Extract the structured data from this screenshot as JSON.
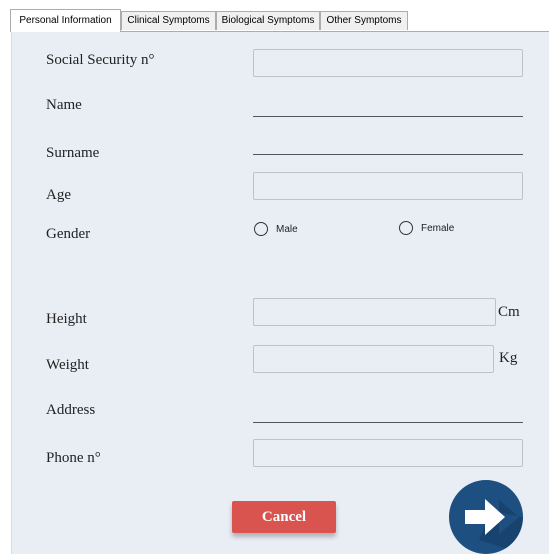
{
  "tabs": [
    {
      "label": "Personal Information",
      "active": true
    },
    {
      "label": "Clinical Symptoms",
      "active": false
    },
    {
      "label": "Biological Symptoms",
      "active": false
    },
    {
      "label": "Other Symptoms",
      "active": false
    }
  ],
  "form": {
    "ssn_label": "Social Security n°",
    "ssn_value": "",
    "name_label": "Name",
    "name_value": "",
    "surname_label": "Surname",
    "surname_value": "",
    "age_label": "Age",
    "age_value": "",
    "gender_label": "Gender",
    "gender_male": "Male",
    "gender_female": "Female",
    "height_label": "Height",
    "height_value": "",
    "height_unit": "Cm",
    "weight_label": "Weight",
    "weight_value": "",
    "weight_unit": "Kg",
    "address_label": "Address",
    "address_value": "",
    "phone_label": "Phone n°",
    "phone_value": ""
  },
  "actions": {
    "cancel_label": "Cancel",
    "next_icon": "arrow-right-icon"
  },
  "colors": {
    "panel_bg": "#e9eef5",
    "cancel_bg": "#d9534f",
    "next_bg": "#1d4f80"
  }
}
